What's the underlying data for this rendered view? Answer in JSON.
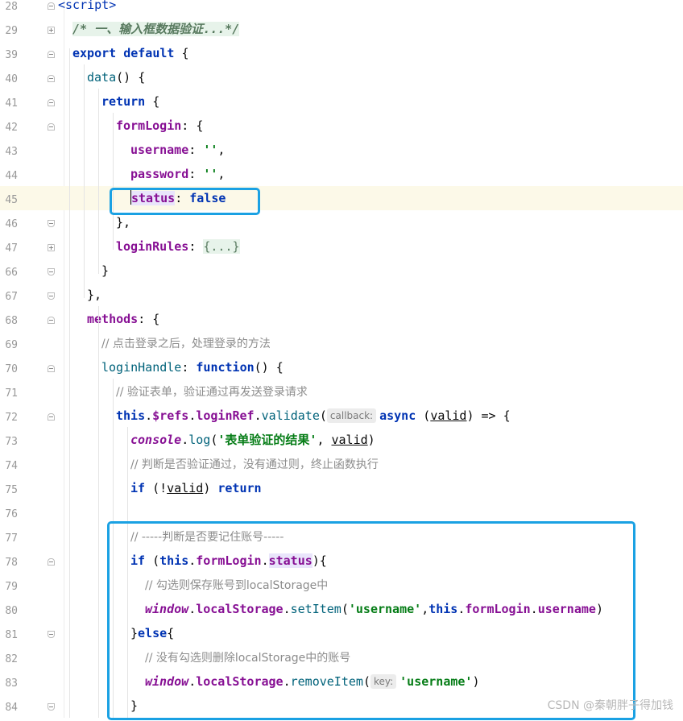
{
  "editor": {
    "lines": [
      {
        "n": "28",
        "fold": "start",
        "code": [
          {
            "t": "<",
            "c": "tag"
          },
          {
            "t": "script",
            "c": "tag"
          },
          {
            "t": ">",
            "c": "tag"
          }
        ]
      },
      {
        "n": "29",
        "fold": "plus",
        "code": [
          {
            "t": "/* 一、输入框数据验证...*/",
            "c": "cmtb fold-bg"
          }
        ]
      },
      {
        "n": "39",
        "fold": "start",
        "code": [
          {
            "t": "export default",
            "c": "kw"
          },
          {
            "t": " {",
            "c": ""
          }
        ]
      },
      {
        "n": "40",
        "fold": "start",
        "code": [
          {
            "t": "data",
            "c": "fn"
          },
          {
            "t": "() {",
            "c": ""
          }
        ]
      },
      {
        "n": "41",
        "fold": "start",
        "code": [
          {
            "t": "return",
            "c": "kw"
          },
          {
            "t": " {",
            "c": ""
          }
        ]
      },
      {
        "n": "42",
        "fold": "start",
        "code": [
          {
            "t": "formLogin",
            "c": "prop"
          },
          {
            "t": ": {",
            "c": ""
          }
        ]
      },
      {
        "n": "43",
        "fold": "",
        "code": [
          {
            "t": "username",
            "c": "prop"
          },
          {
            "t": ": ",
            "c": ""
          },
          {
            "t": "''",
            "c": "str"
          },
          {
            "t": ",",
            "c": ""
          }
        ]
      },
      {
        "n": "44",
        "fold": "",
        "code": [
          {
            "t": "password",
            "c": "prop"
          },
          {
            "t": ": ",
            "c": ""
          },
          {
            "t": "''",
            "c": "str"
          },
          {
            "t": ",",
            "c": ""
          }
        ]
      },
      {
        "n": "45",
        "fold": "",
        "current": true,
        "code": [
          {
            "t": "status",
            "c": "prop hl",
            "caret": true
          },
          {
            "t": ": ",
            "c": ""
          },
          {
            "t": "false",
            "c": "kw"
          }
        ]
      },
      {
        "n": "46",
        "fold": "end",
        "code": [
          {
            "t": "},",
            "c": ""
          }
        ]
      },
      {
        "n": "47",
        "fold": "plus",
        "code": [
          {
            "t": "loginRules",
            "c": "prop"
          },
          {
            "t": ": ",
            "c": ""
          },
          {
            "t": "{...}",
            "c": "fold-bg"
          }
        ]
      },
      {
        "n": "66",
        "fold": "end",
        "code": [
          {
            "t": "}",
            "c": ""
          }
        ]
      },
      {
        "n": "67",
        "fold": "end",
        "code": [
          {
            "t": "},",
            "c": ""
          }
        ]
      },
      {
        "n": "68",
        "fold": "start",
        "code": [
          {
            "t": "methods",
            "c": "prop"
          },
          {
            "t": ": {",
            "c": ""
          }
        ]
      },
      {
        "n": "69",
        "fold": "",
        "code": [
          {
            "t": "// 点击登录之后，处理登录的方法",
            "c": "cmt"
          }
        ]
      },
      {
        "n": "70",
        "fold": "start",
        "code": [
          {
            "t": "loginHandle",
            "c": "fn"
          },
          {
            "t": ": ",
            "c": ""
          },
          {
            "t": "function",
            "c": "kw"
          },
          {
            "t": "() {",
            "c": ""
          }
        ]
      },
      {
        "n": "71",
        "fold": "",
        "code": [
          {
            "t": "// 验证表单，验证通过再发送登录请求",
            "c": "cmt"
          }
        ]
      },
      {
        "n": "72",
        "fold": "start",
        "code": [
          {
            "t": "this",
            "c": "kw"
          },
          {
            "t": ".",
            "c": ""
          },
          {
            "t": "$refs",
            "c": "prop"
          },
          {
            "t": ".",
            "c": ""
          },
          {
            "t": "loginRef",
            "c": "prop"
          },
          {
            "t": ".",
            "c": ""
          },
          {
            "t": "validate",
            "c": "fn"
          },
          {
            "t": "(",
            "c": ""
          },
          {
            "t": "callback:",
            "c": "hint"
          },
          {
            "t": "async",
            "c": "kw"
          },
          {
            "t": " (",
            "c": ""
          },
          {
            "t": "valid",
            "c": "ul"
          },
          {
            "t": ") => {",
            "c": ""
          }
        ]
      },
      {
        "n": "73",
        "fold": "",
        "code": [
          {
            "t": "console",
            "c": "glob"
          },
          {
            "t": ".",
            "c": ""
          },
          {
            "t": "log",
            "c": "fn"
          },
          {
            "t": "(",
            "c": ""
          },
          {
            "t": "'表单验证的结果'",
            "c": "str"
          },
          {
            "t": ", ",
            "c": ""
          },
          {
            "t": "valid",
            "c": "ul"
          },
          {
            "t": ")",
            "c": ""
          }
        ]
      },
      {
        "n": "74",
        "fold": "",
        "code": [
          {
            "t": "// 判断是否验证通过，没有通过则，终止函数执行",
            "c": "cmt"
          }
        ]
      },
      {
        "n": "75",
        "fold": "",
        "code": [
          {
            "t": "if",
            "c": "kw"
          },
          {
            "t": " (!",
            "c": ""
          },
          {
            "t": "valid",
            "c": "ul"
          },
          {
            "t": ") ",
            "c": ""
          },
          {
            "t": "return",
            "c": "kw"
          }
        ]
      },
      {
        "n": "76",
        "fold": "",
        "code": []
      },
      {
        "n": "77",
        "fold": "",
        "code": [
          {
            "t": "// -----判断是否要记住账号-----",
            "c": "cmt"
          }
        ]
      },
      {
        "n": "78",
        "fold": "start",
        "code": [
          {
            "t": "if",
            "c": "kw"
          },
          {
            "t": " (",
            "c": ""
          },
          {
            "t": "this",
            "c": "kw"
          },
          {
            "t": ".",
            "c": ""
          },
          {
            "t": "formLogin",
            "c": "prop"
          },
          {
            "t": ".",
            "c": ""
          },
          {
            "t": "status",
            "c": "prop hl"
          },
          {
            "t": "){",
            "c": ""
          }
        ]
      },
      {
        "n": "79",
        "fold": "",
        "code": [
          {
            "t": "// 勾选则保存账号到",
            "c": "cmt"
          },
          {
            "t": "localStorage",
            "c": "cmt mono"
          },
          {
            "t": "中",
            "c": "cmt"
          }
        ]
      },
      {
        "n": "80",
        "fold": "",
        "code": [
          {
            "t": "window",
            "c": "glob"
          },
          {
            "t": ".",
            "c": ""
          },
          {
            "t": "localStorage",
            "c": "prop"
          },
          {
            "t": ".",
            "c": ""
          },
          {
            "t": "setItem",
            "c": "fn"
          },
          {
            "t": "(",
            "c": ""
          },
          {
            "t": "'username'",
            "c": "str"
          },
          {
            "t": ",",
            "c": ""
          },
          {
            "t": "this",
            "c": "kw"
          },
          {
            "t": ".",
            "c": ""
          },
          {
            "t": "formLogin",
            "c": "prop"
          },
          {
            "t": ".",
            "c": ""
          },
          {
            "t": "username",
            "c": "prop"
          },
          {
            "t": ")",
            "c": ""
          }
        ]
      },
      {
        "n": "81",
        "fold": "end",
        "code": [
          {
            "t": "}",
            "c": ""
          },
          {
            "t": "else",
            "c": "kw"
          },
          {
            "t": "{",
            "c": ""
          }
        ]
      },
      {
        "n": "82",
        "fold": "",
        "code": [
          {
            "t": "// 没有勾选则删除",
            "c": "cmt"
          },
          {
            "t": "localStorage",
            "c": "cmt mono"
          },
          {
            "t": "中的账号",
            "c": "cmt"
          }
        ]
      },
      {
        "n": "83",
        "fold": "",
        "code": [
          {
            "t": "window",
            "c": "glob"
          },
          {
            "t": ".",
            "c": ""
          },
          {
            "t": "localStorage",
            "c": "prop"
          },
          {
            "t": ".",
            "c": ""
          },
          {
            "t": "removeItem",
            "c": "fn"
          },
          {
            "t": "(",
            "c": ""
          },
          {
            "t": "key:",
            "c": "hint"
          },
          {
            "t": "'username'",
            "c": "str"
          },
          {
            "t": ")",
            "c": ""
          }
        ]
      },
      {
        "n": "84",
        "fold": "end",
        "code": [
          {
            "t": "}",
            "c": ""
          }
        ]
      }
    ]
  },
  "watermark": "CSDN @秦朝胖子得加钱"
}
